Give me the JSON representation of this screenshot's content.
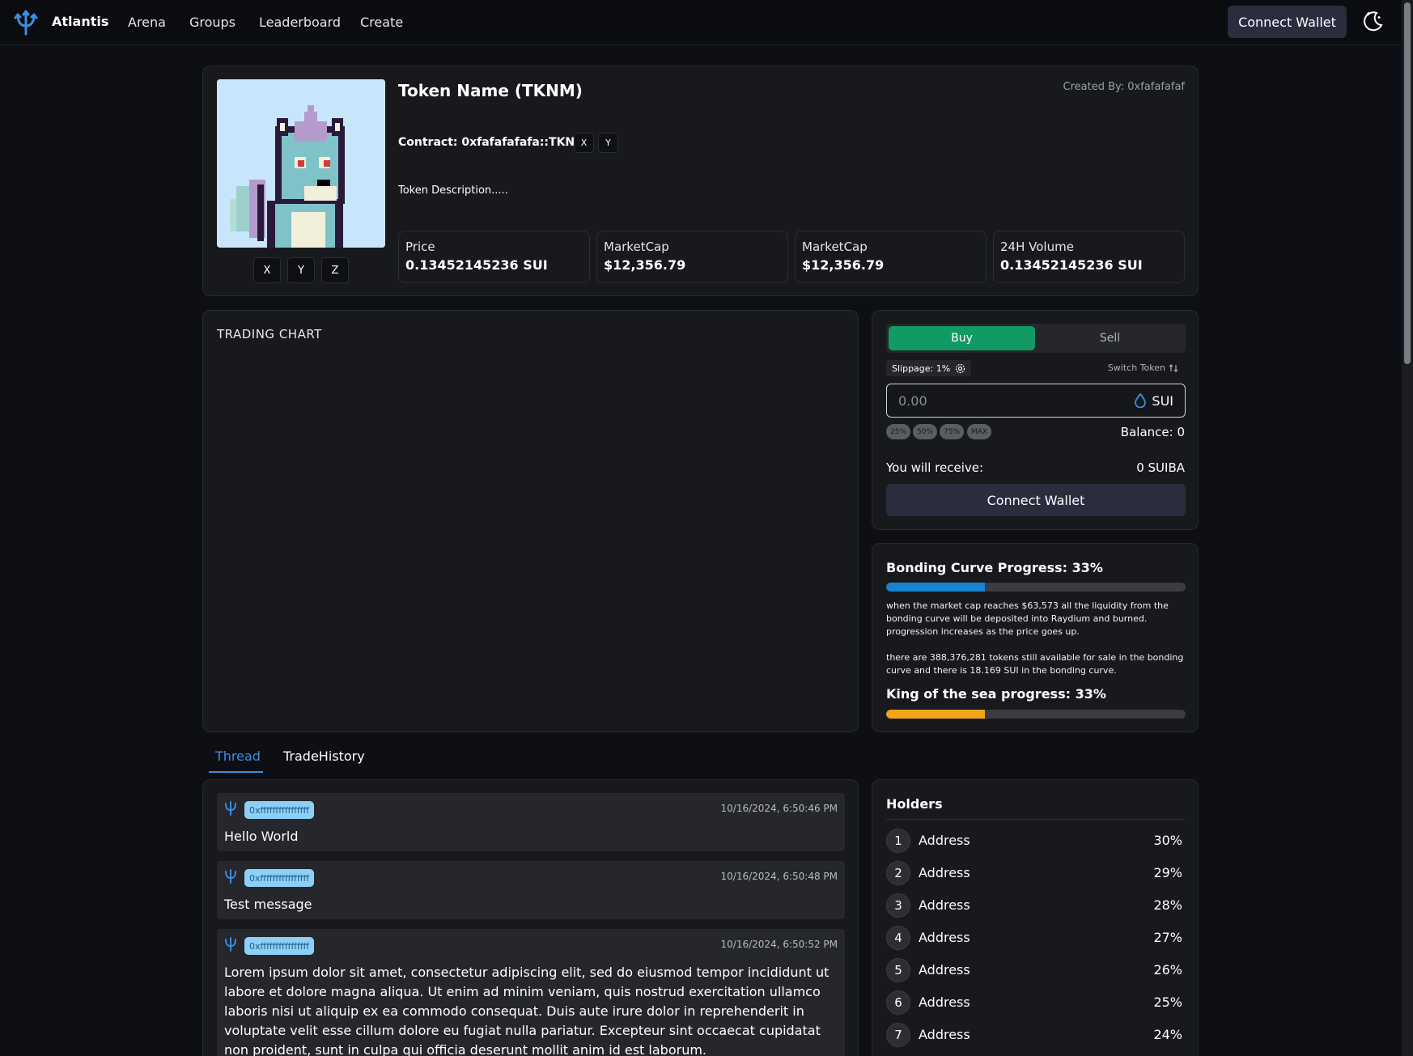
{
  "nav": {
    "brand": "Atlantis",
    "links": [
      "Arena",
      "Groups",
      "Leaderboard",
      "Create"
    ],
    "connect_label": "Connect Wallet"
  },
  "token": {
    "name": "Token Name (TKNM)",
    "created_by": "Created By: 0xfafafafaf",
    "contract": "Contract: 0xfafafafafa::TKNM",
    "contract_buttons": [
      "X",
      "Y"
    ],
    "social_buttons": [
      "X",
      "Y",
      "Z"
    ],
    "description": "Token Description.....",
    "stats": [
      {
        "label": "Price",
        "value": "0.13452145236 SUI"
      },
      {
        "label": "MarketCap",
        "value": "$12,356.79"
      },
      {
        "label": "MarketCap",
        "value": "$12,356.79"
      },
      {
        "label": "24H Volume",
        "value": "0.13452145236 SUI"
      }
    ]
  },
  "chart": {
    "title": "TRADING CHART"
  },
  "trade": {
    "buy_label": "Buy",
    "sell_label": "Sell",
    "slippage": "Slippage: 1%",
    "switch_label": "Switch Token",
    "amount_placeholder": "0.00",
    "unit": "SUI",
    "percent_buttons": [
      "25%",
      "50%",
      "75%",
      "MAX"
    ],
    "balance": "Balance: 0",
    "receive_label": "You will receive:",
    "receive_value": "0 SUIBA",
    "connect_label": "Connect Wallet"
  },
  "bonding": {
    "title": "Bonding Curve Progress: 33%",
    "progress": 0.33,
    "text1": "when the market cap reaches $63,573 all the liquidity from the bonding curve will be deposited into Raydium and burned. progression increases as the price goes up.",
    "text2": "there are 388,376,281 tokens still available for sale in the bonding curve and there is 18.169 SUI in the bonding curve.",
    "king_title": "King of the sea progress: 33%",
    "king_progress": 0.33
  },
  "tabs": [
    "Thread",
    "TradeHistory"
  ],
  "thread": [
    {
      "address": "0xffffffffffffffff",
      "time": "10/16/2024, 6:50:46 PM",
      "text": "Hello World"
    },
    {
      "address": "0xffffffffffffffff",
      "time": "10/16/2024, 6:50:48 PM",
      "text": "Test message"
    },
    {
      "address": "0xffffffffffffffff",
      "time": "10/16/2024, 6:50:52 PM",
      "text": "Lorem ipsum dolor sit amet, consectetur adipiscing elit, sed do eiusmod tempor incididunt ut labore et dolore magna aliqua. Ut enim ad minim veniam, quis nostrud exercitation ullamco laboris nisi ut aliquip ex ea commodo consequat. Duis aute irure dolor in reprehenderit in voluptate velit esse cillum dolore eu fugiat nulla pariatur. Excepteur sint occaecat cupidatat non proident, sunt in culpa qui officia deserunt mollit anim id est laborum."
    }
  ],
  "holders": {
    "title": "Holders",
    "rows": [
      {
        "rank": "1",
        "address": "Address",
        "percent": "30%"
      },
      {
        "rank": "2",
        "address": "Address",
        "percent": "29%"
      },
      {
        "rank": "3",
        "address": "Address",
        "percent": "28%"
      },
      {
        "rank": "4",
        "address": "Address",
        "percent": "27%"
      },
      {
        "rank": "5",
        "address": "Address",
        "percent": "26%"
      },
      {
        "rank": "6",
        "address": "Address",
        "percent": "25%"
      },
      {
        "rank": "7",
        "address": "Address",
        "percent": "24%"
      }
    ]
  },
  "colors": {
    "accent": "#3d8de0",
    "buy": "#119a63",
    "bonding_bar": "#1784d0",
    "king_bar": "#f0a418",
    "address_badge": "#8ed0f5"
  }
}
